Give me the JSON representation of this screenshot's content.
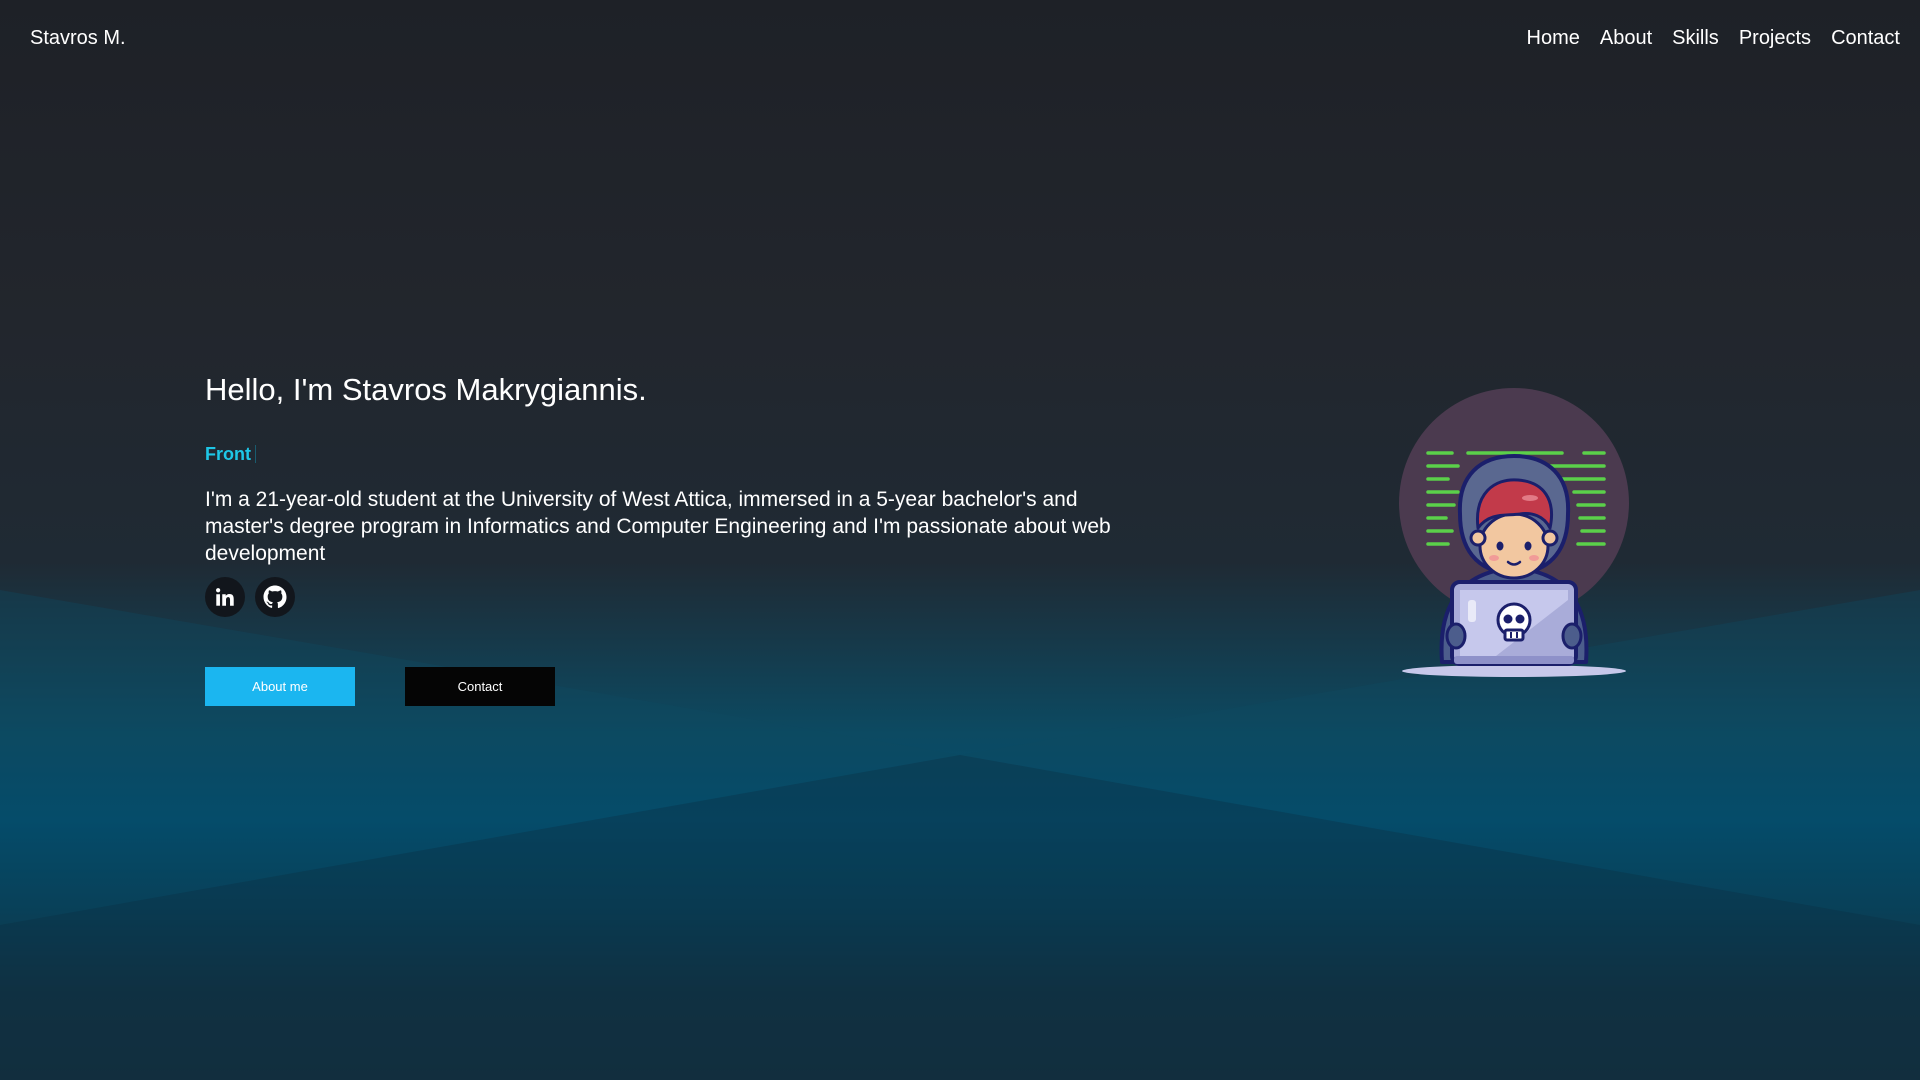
{
  "header": {
    "brand": "Stavros M.",
    "nav": [
      "Home",
      "About",
      "Skills",
      "Projects",
      "Contact"
    ]
  },
  "hero": {
    "title": "Hello, I'm Stavros Makrygiannis.",
    "typed_text": "Front",
    "description": "I'm a 21-year-old student at the University of West Attica, immersed in a 5-year bachelor's and master's degree program in Informatics and Computer Engineering and I'm passionate about web development",
    "socials": [
      {
        "name": "linkedin-icon"
      },
      {
        "name": "github-icon"
      }
    ],
    "buttons": {
      "about": "About me",
      "contact": "Contact"
    },
    "illustration": "hacker-coding-on-laptop-illustration"
  },
  "colors": {
    "accent": "#1ec6e6",
    "primary_button": "#1bb6f0",
    "secondary_button": "#050505",
    "background_dark": "#1e2127",
    "background_teal": "#004d6f"
  }
}
